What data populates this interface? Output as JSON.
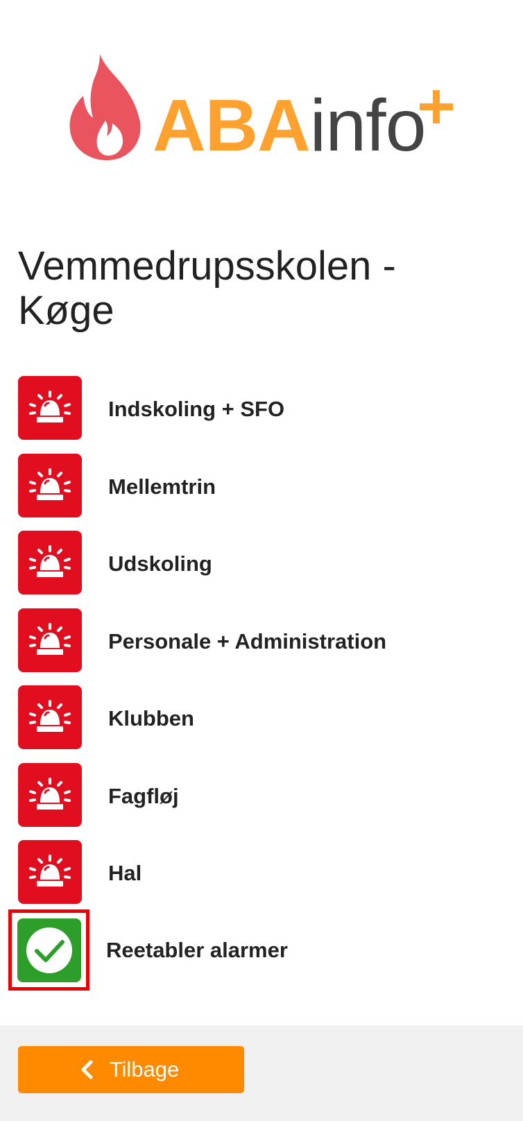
{
  "logo": {
    "brand_strong": "ABA",
    "brand_light": "info",
    "colors": {
      "flame": "#e9545f",
      "brand_strong": "#ffa12e",
      "brand_light": "#444444",
      "plus": "#ffa12e"
    },
    "icons": [
      "flame-icon",
      "plus-icon"
    ]
  },
  "page": {
    "title": "Vemmedrupsskolen - Køge"
  },
  "alarms": {
    "items": [
      {
        "label": "Indskoling + SFO",
        "icon": "siren-icon"
      },
      {
        "label": "Mellemtrin",
        "icon": "siren-icon"
      },
      {
        "label": "Udskoling",
        "icon": "siren-icon"
      },
      {
        "label": "Personale + Administration",
        "icon": "siren-icon"
      },
      {
        "label": "Klubben",
        "icon": "siren-icon"
      },
      {
        "label": "Fagfløj",
        "icon": "siren-icon"
      },
      {
        "label": "Hal",
        "icon": "siren-icon"
      }
    ],
    "tile_color": "#e10e1f"
  },
  "reset": {
    "label": "Reetabler alarmer",
    "icon": "check-circle-icon",
    "tile_color": "#2e9e2a",
    "highlight_color": "#ee0000"
  },
  "footer": {
    "back_label": "Tilbage",
    "back_icon": "chevron-left-icon",
    "button_color": "#ff8a00"
  }
}
